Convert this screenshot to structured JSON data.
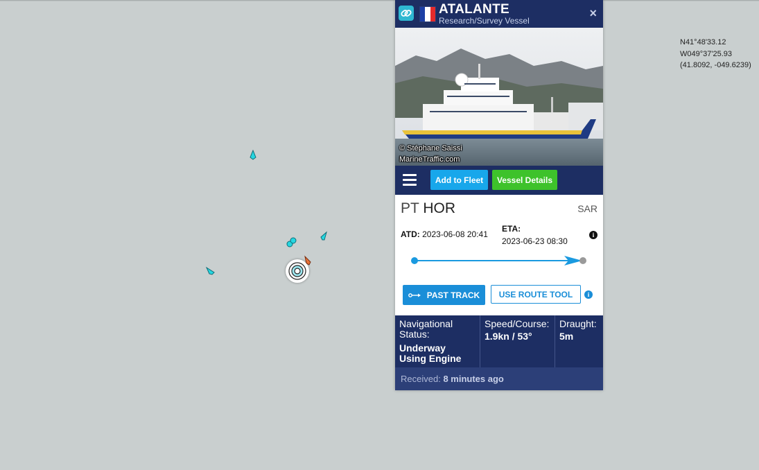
{
  "map": {
    "coordinates": {
      "dms_lat": "N41°48'33.12",
      "dms_lon": "W049°37'25.93",
      "decimal": "(41.8092, -049.6239)"
    },
    "colors": {
      "water": "#c9cfcf",
      "vessel": "#26d6e0",
      "selected_vessel": "#e8733a"
    }
  },
  "panel": {
    "header": {
      "vessel_name": "ATALANTE",
      "vessel_type": "Research/Survey Vessel",
      "flag": "france-flag",
      "close_label": "×"
    },
    "photo": {
      "credit_line1": "© Stéphane Saissi",
      "credit_line2": "MarineTraffic.com"
    },
    "toolbar": {
      "add_fleet_label": "Add to Fleet",
      "details_label": "Vessel Details"
    },
    "voyage": {
      "from_code": "PT",
      "from_port": "HOR",
      "to_port": "SAR",
      "atd_label": "ATD:",
      "atd_value": "2023-06-08 20:41",
      "eta_label": "ETA:",
      "eta_value": "2023-06-23 08:30",
      "info_glyph": "i",
      "past_track_label": "PAST TRACK",
      "route_tool_label": "USE ROUTE TOOL"
    },
    "stats": {
      "nav_status_label_1": "Navigational",
      "nav_status_label_2": "Status:",
      "nav_status_value_1": "Underway",
      "nav_status_value_2": "Using Engine",
      "speed_label": "Speed/Course:",
      "speed_value": "1.9kn / 53°",
      "draught_label": "Draught:",
      "draught_value": "5m"
    },
    "received": {
      "label": "Received:",
      "value": "8 minutes ago"
    },
    "colors": {
      "navy": "#1d2e63",
      "blue": "#18a7eb",
      "green": "#3ec22b",
      "progress": "#1a9ae0"
    }
  }
}
